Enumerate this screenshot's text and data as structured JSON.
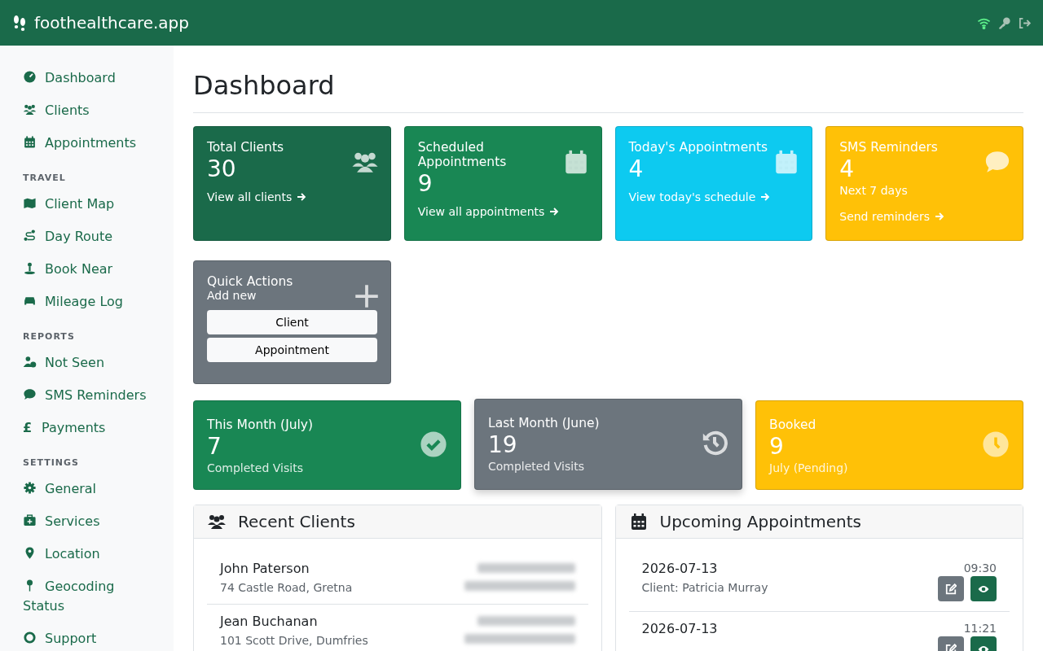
{
  "header": {
    "brand": "foothealthcare.app"
  },
  "sidebar": {
    "sections": [
      {
        "items": [
          {
            "label": "Dashboard"
          },
          {
            "label": "Clients"
          },
          {
            "label": "Appointments"
          }
        ]
      },
      {
        "heading": "TRAVEL",
        "items": [
          {
            "label": "Client Map"
          },
          {
            "label": "Day Route"
          },
          {
            "label": "Book Near"
          },
          {
            "label": "Mileage Log"
          }
        ]
      },
      {
        "heading": "REPORTS",
        "items": [
          {
            "label": "Not Seen"
          },
          {
            "label": "SMS Reminders"
          },
          {
            "label": "Payments",
            "glyph": "£"
          }
        ]
      },
      {
        "heading": "SETTINGS",
        "items": [
          {
            "label": "General"
          },
          {
            "label": "Services"
          },
          {
            "label": "Location"
          },
          {
            "label": "Geocoding Status"
          },
          {
            "label": "Support"
          }
        ]
      }
    ]
  },
  "page_title": "Dashboard",
  "stat_cards": [
    {
      "title": "Total Clients",
      "value": "30",
      "link": "View all clients",
      "color": "#1a6a4a"
    },
    {
      "title": "Scheduled Appointments",
      "value": "9",
      "link": "View all appointments",
      "color": "#198754"
    },
    {
      "title": "Today's Appointments",
      "value": "4",
      "link": "View today's schedule",
      "color": "#0dcaf0"
    },
    {
      "title": "SMS Reminders",
      "value": "4",
      "note": "Next 7 days",
      "link": "Send reminders",
      "color": "#ffc107"
    }
  ],
  "quick_actions": {
    "title": "Quick Actions",
    "subtitle": "Add new",
    "buttons": [
      "Client",
      "Appointment"
    ]
  },
  "visit_cards": [
    {
      "title": "This Month (July)",
      "value": "7",
      "subtitle": "Completed Visits",
      "color": "#198754"
    },
    {
      "title": "Last Month (June)",
      "value": "19",
      "subtitle": "Completed Visits",
      "color": "#6c757d"
    },
    {
      "title": "Booked",
      "value": "9",
      "subtitle": "July (Pending)",
      "color": "#ffc107"
    }
  ],
  "recent_clients": {
    "title": "Recent Clients",
    "clients": [
      {
        "name": "John Paterson",
        "address": "74 Castle Road, Gretna"
      },
      {
        "name": "Jean Buchanan",
        "address": "101 Scott Drive, Dumfries"
      }
    ]
  },
  "upcoming": {
    "title": "Upcoming Appointments",
    "appointments": [
      {
        "date": "2026-07-13",
        "client": "Client: Patricia Murray",
        "time": "09:30"
      },
      {
        "date": "2026-07-13",
        "time": "11:21"
      }
    ]
  }
}
